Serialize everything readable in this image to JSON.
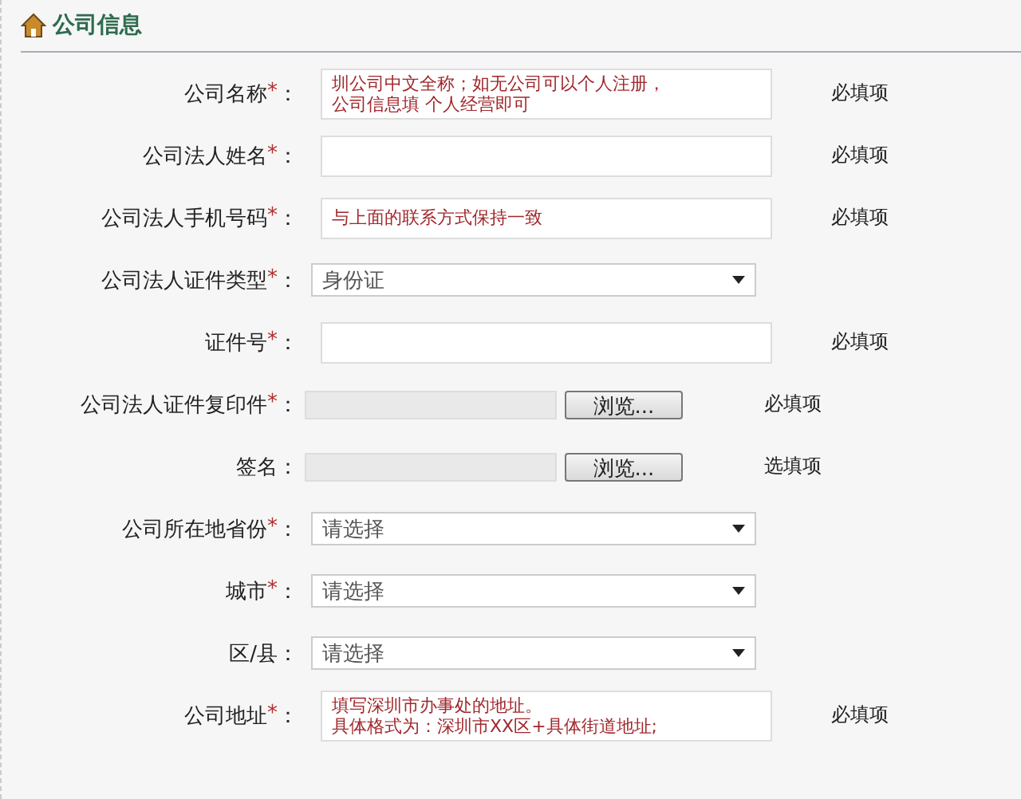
{
  "section": {
    "title": "公司信息"
  },
  "rows": [
    {
      "kind": "text",
      "label": "公司名称",
      "mark": "*",
      "colon": "：",
      "note_lines": [
        "圳公司中文全称；如无公司可以个人注册，",
        "公司信息填 个人经营即可"
      ],
      "hint": "必填项"
    },
    {
      "kind": "text",
      "label": "公司法人姓名",
      "mark": "*",
      "colon": "：",
      "hint": "必填项"
    },
    {
      "kind": "text",
      "label": "公司法人手机号码",
      "mark": "*",
      "colon": "：",
      "note_lines": [
        "与上面的联系方式保持一致"
      ],
      "hint": "必填项"
    },
    {
      "kind": "select",
      "label": "公司法人证件类型",
      "mark": "*",
      "colon": "：",
      "value": "身份证"
    },
    {
      "kind": "text",
      "label": "证件号",
      "mark": "*",
      "colon": "：",
      "hint": "必填项"
    },
    {
      "kind": "file",
      "label": "公司法人证件复印件",
      "mark": "*",
      "colon": "：",
      "button": "浏览...",
      "hint": "必填项"
    },
    {
      "kind": "file",
      "label": "签名",
      "colon": "：",
      "button": "浏览...",
      "hint": "选填项"
    },
    {
      "kind": "select",
      "label": "公司所在地省份",
      "mark": "*",
      "colon": "：",
      "value": "请选择"
    },
    {
      "kind": "select",
      "label": "城市",
      "mark": "*",
      "colon": "：",
      "value": "请选择"
    },
    {
      "kind": "select",
      "label": "区/县",
      "colon": "：",
      "value": "请选择"
    },
    {
      "kind": "text",
      "label": "公司地址",
      "mark": "*",
      "colon": "：",
      "note_lines": [
        "填写深圳市办事处的地址。",
        "具体格式为：深圳市XX区+具体街道地址;"
      ],
      "hint": "必填项"
    }
  ]
}
